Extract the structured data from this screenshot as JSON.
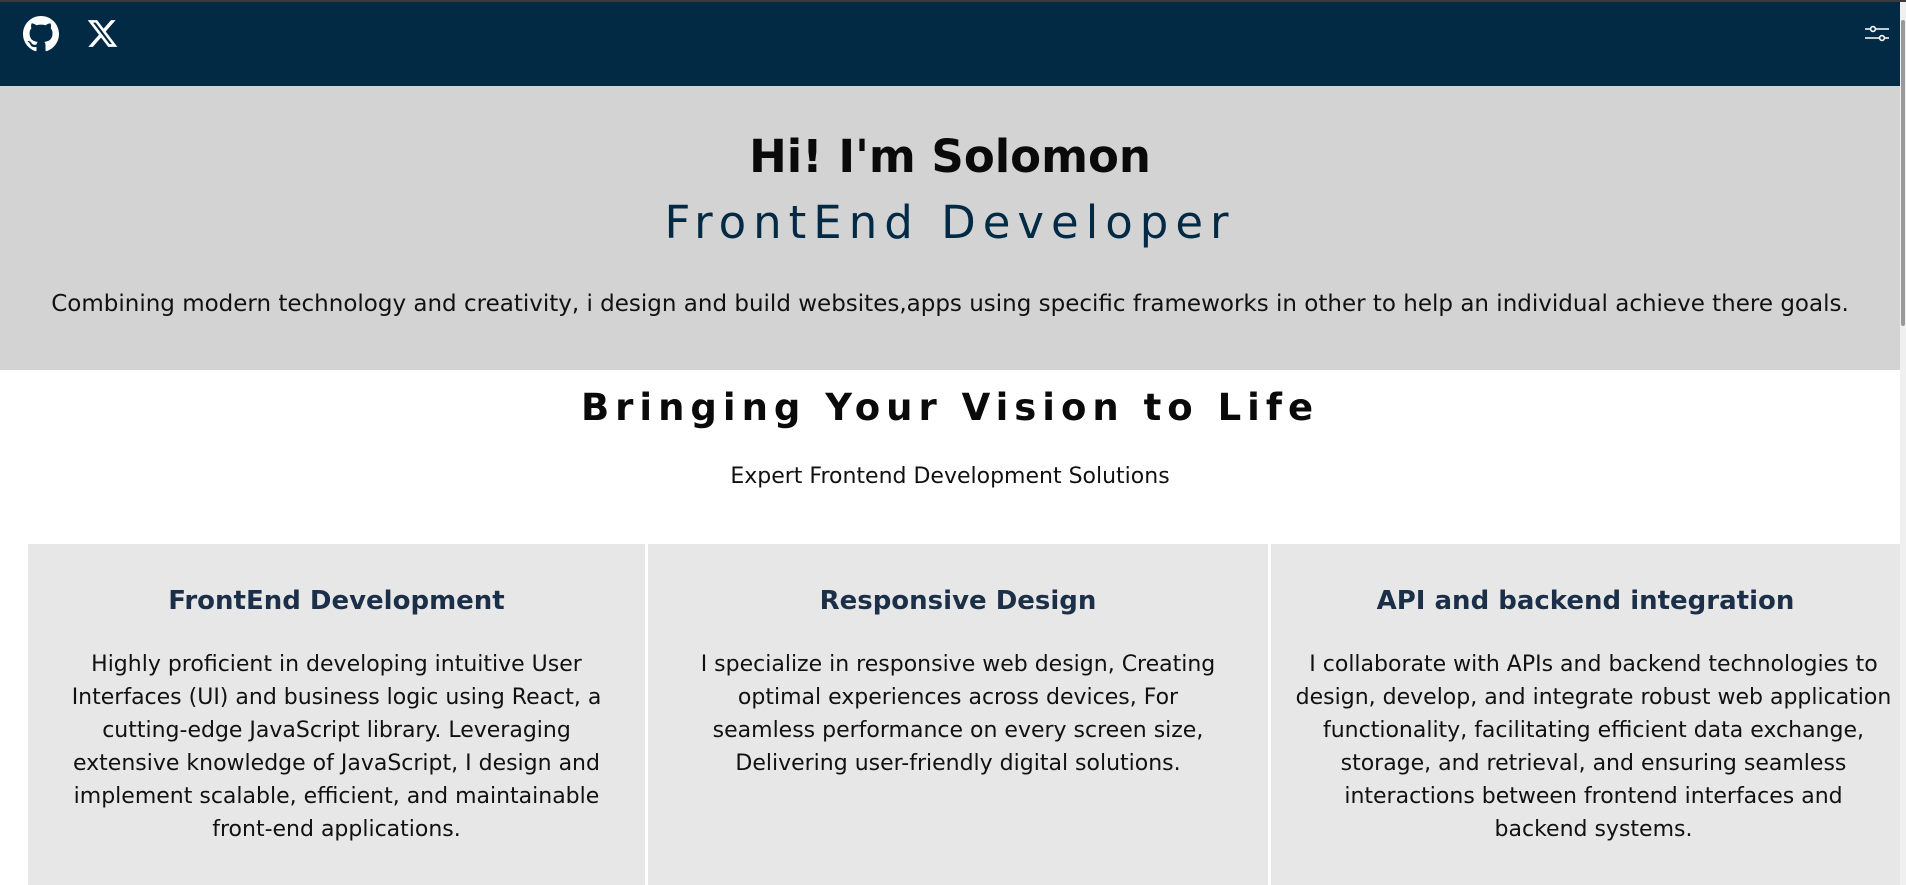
{
  "navbar": {
    "github_icon": "github-icon",
    "x_icon": "x-twitter-icon",
    "settings_icon": "sliders-icon",
    "background": "#032a45"
  },
  "hero": {
    "greeting": "Hi! I'm Solomon",
    "role": "FrontEnd Developer",
    "description": "Combining modern technology and creativity, i design and build websites,apps using specific frameworks in other to help an individual achieve there goals."
  },
  "services": {
    "title": "Bringing Your Vision to Life",
    "subtitle": "Expert Frontend Development Solutions",
    "cards": [
      {
        "title": "FrontEnd Development",
        "text": "Highly proficient in developing intuitive User Interfaces (UI) and business logic using React, a cutting-edge JavaScript library. Leveraging extensive knowledge of JavaScript, I design and implement scalable, efficient, and maintainable front-end applications."
      },
      {
        "title": "Responsive Design",
        "text": "I specialize in responsive web design, Creating optimal experiences across devices, For seamless performance on every screen size, Delivering user-friendly digital solutions."
      },
      {
        "title": "API and backend integration",
        "text": "I collaborate with APIs and backend technologies to design, develop, and integrate robust web application functionality, facilitating efficient data exchange, storage, and retrieval, and ensuring seamless interactions between frontend interfaces and backend systems."
      }
    ]
  },
  "colors": {
    "hero_bg": "#d3d3d3",
    "card_bg": "#e7e7e7",
    "accent": "#032a45"
  }
}
